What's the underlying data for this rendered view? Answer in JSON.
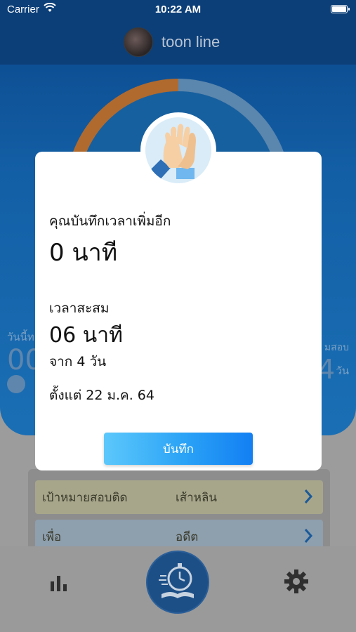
{
  "status_bar": {
    "carrier": "Carrier",
    "time": "10:22 AM"
  },
  "profile": {
    "name": "toon line"
  },
  "background": {
    "left_label": "วันนี้ท",
    "left_value": "00",
    "right_label": "มสอบ",
    "right_value": "4",
    "right_unit": "วัน",
    "goal_row": {
      "label": "เป้าหมายสอบติด",
      "value": "เส้าหลิน"
    },
    "for_row": {
      "label": "เพื่อ",
      "value": "อดีต"
    }
  },
  "tabs": [
    "chart-icon",
    "stopwatch-book-icon",
    "gear-icon"
  ],
  "modal": {
    "added_label": "คุณบันทึกเวลาเพิ่มอีก",
    "added_value": "0 นาที",
    "total_label": "เวลาสะสม",
    "total_value": "06 นาที",
    "days_text": "จาก 4 วัน",
    "since_text": "ตั้งแต่ 22 ม.ค. 64",
    "save_label": "บันทึก"
  },
  "colors": {
    "save_button_start": "#5cc8fb",
    "save_button_end": "#137ff3",
    "modal_bg": "#ffffff"
  }
}
